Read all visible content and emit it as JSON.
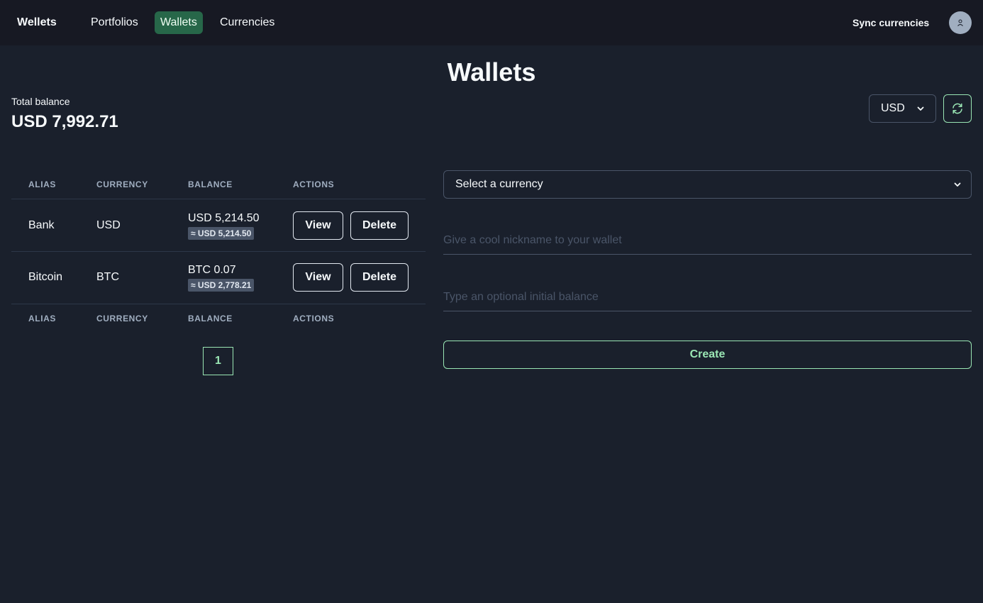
{
  "nav": {
    "brand": "Wellets",
    "links": [
      {
        "label": "Portfolios",
        "active": false
      },
      {
        "label": "Wallets",
        "active": true
      },
      {
        "label": "Currencies",
        "active": false
      }
    ],
    "sync_label": "Sync currencies",
    "avatar_icon": "user-icon"
  },
  "page": {
    "title": "Wallets",
    "total_balance_label": "Total balance",
    "total_balance_value": "USD 7,992.71",
    "currency_selected": "USD",
    "refresh_icon": "refresh-icon"
  },
  "table": {
    "headers": [
      "ALIAS",
      "CURRENCY",
      "BALANCE",
      "ACTIONS"
    ],
    "rows": [
      {
        "alias": "Bank",
        "currency": "USD",
        "balance": "USD 5,214.50",
        "converted": "≈ USD 5,214.50",
        "view_label": "View",
        "delete_label": "Delete"
      },
      {
        "alias": "Bitcoin",
        "currency": "BTC",
        "balance": "BTC 0.07",
        "converted": "≈ USD 2,778.21",
        "view_label": "View",
        "delete_label": "Delete"
      }
    ],
    "pagination": {
      "current_page": "1"
    }
  },
  "form": {
    "currency_placeholder": "Select a currency",
    "nickname_placeholder": "Give a cool nickname to your wallet",
    "balance_placeholder": "Type an optional initial balance",
    "create_label": "Create"
  },
  "colors": {
    "background": "#1a202c",
    "navbar": "#171923",
    "accent_green": "#9ae6b4",
    "active_nav": "#276749"
  }
}
